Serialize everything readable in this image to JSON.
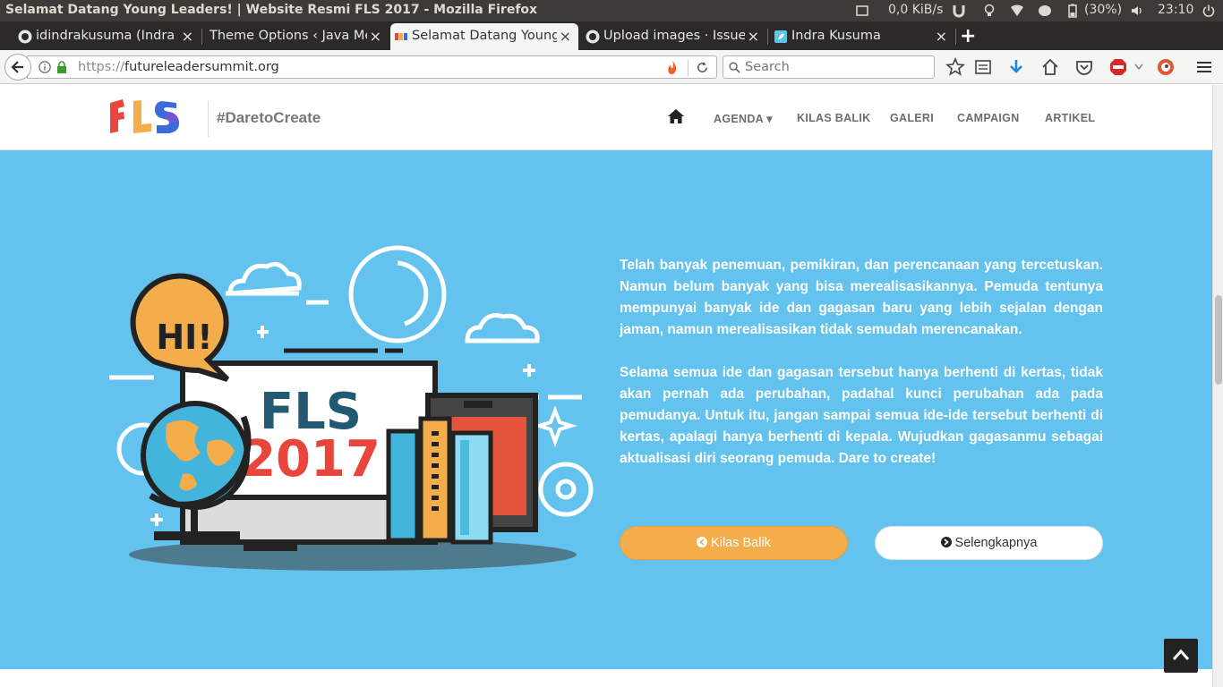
{
  "os": {
    "window_title": "Selamat Datang Young Leaders! | Website Resmi FLS 2017 - Mozilla Firefox",
    "net_speed": "0,0 KiB/s",
    "battery": "(30%)",
    "clock": "23:10"
  },
  "tabs": [
    {
      "label": "idindrakusuma (Indra Kusuma)",
      "favicon": "github-icon"
    },
    {
      "label": "Theme Options ‹ Java Media",
      "favicon": "none"
    },
    {
      "label": "Selamat Datang Young Leaders!",
      "favicon": "fls-icon",
      "active": true
    },
    {
      "label": "Upload images · Issue #",
      "favicon": "github-icon"
    },
    {
      "label": "Indra Kusuma",
      "favicon": "bird-icon"
    }
  ],
  "tab_close_glyph": "×",
  "new_tab_glyph": "+",
  "navbar": {
    "url_proto": "https://",
    "url_host": "futureleadersummit.org",
    "search_placeholder": "Search"
  },
  "site": {
    "hashtag": "#DaretoCreate",
    "menu": [
      {
        "label": "AGENDA ▾"
      },
      {
        "label": "KILAS BALIK"
      },
      {
        "label": "GALERI"
      },
      {
        "label": "CAMPAIGN"
      },
      {
        "label": "ARTIKEL"
      }
    ]
  },
  "hero": {
    "paragraph1": "Telah banyak penemuan, pemikiran, dan perencanaan yang tercetuskan. Namun belum banyak yang bisa merealisasikannya. Pemuda tentunya mempunyai banyak ide dan gagasan baru yang lebih sejalan dengan jaman, namun merealisasikan tidak semudah merencanakan.",
    "paragraph2": "Selama semua ide dan gagasan tersebut hanya berhenti di kertas, tidak akan pernah ada perubahan, padahal kunci perubahan ada pada pemudanya. Untuk itu, jangan sampai semua ide-ide tersebut berhenti di kertas, apalagi hanya berhenti di kepala. Wujudkan gagasanmu sebagai aktualisasi diri seorang pemuda. Dare to create!",
    "btn_kilas": "Kilas Balik",
    "btn_more": "Selengkapnya",
    "illus_hi": "HI!",
    "illus_fls": "FLS",
    "illus_year": "2017"
  },
  "colors": {
    "hero_bg": "#63c3ee",
    "accent_orange": "#f3ad4b",
    "fls_red": "#e8453c",
    "fls_dark": "#235a73"
  }
}
